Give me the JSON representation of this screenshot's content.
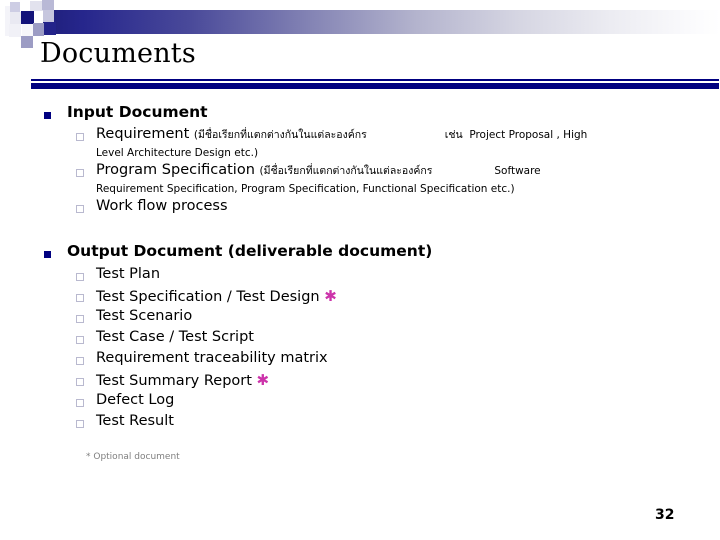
{
  "slide": {
    "title": "Documents",
    "page_number": "32",
    "footnote": "* Optional document",
    "accent_color": "#000080",
    "star_color": "#cc33aa",
    "footnote_color": "#808080"
  },
  "sections": [
    {
      "heading": "Input Document",
      "items": [
        {
          "label": "Requirement ",
          "paren_thai": "(มีชื่อเรียกที่แตกต่างกันในแต่ละองค์กร",
          "thai_eg": "เช่น",
          "examples": "Project Proposal , High",
          "continuation": "Level Architecture Design etc.)"
        },
        {
          "label": "Program Specification ",
          "paren_thai": "(มีชื่อเรียกที่แตกต่างกันในแต่ละองค์กร",
          "thai_eg": "",
          "examples": "Software",
          "continuation": "Requirement Specification, Program Specification, Functional Specification etc.)"
        },
        {
          "label": "Work flow process",
          "paren_thai": "",
          "thai_eg": "",
          "examples": "",
          "continuation": ""
        }
      ]
    },
    {
      "heading": "Output Document (deliverable document)",
      "items": [
        {
          "label": "Test Plan",
          "optional": false
        },
        {
          "label": "Test Specification / Test Design",
          "optional": true
        },
        {
          "label": "Test Scenario",
          "optional": false
        },
        {
          "label": "Test Case / Test Script",
          "optional": false
        },
        {
          "label": "Requirement traceability matrix",
          "optional": false
        },
        {
          "label": "Test Summary Report",
          "optional": true
        },
        {
          "label": "Defect Log",
          "optional": false
        },
        {
          "label": "Test Result",
          "optional": false
        }
      ]
    }
  ]
}
